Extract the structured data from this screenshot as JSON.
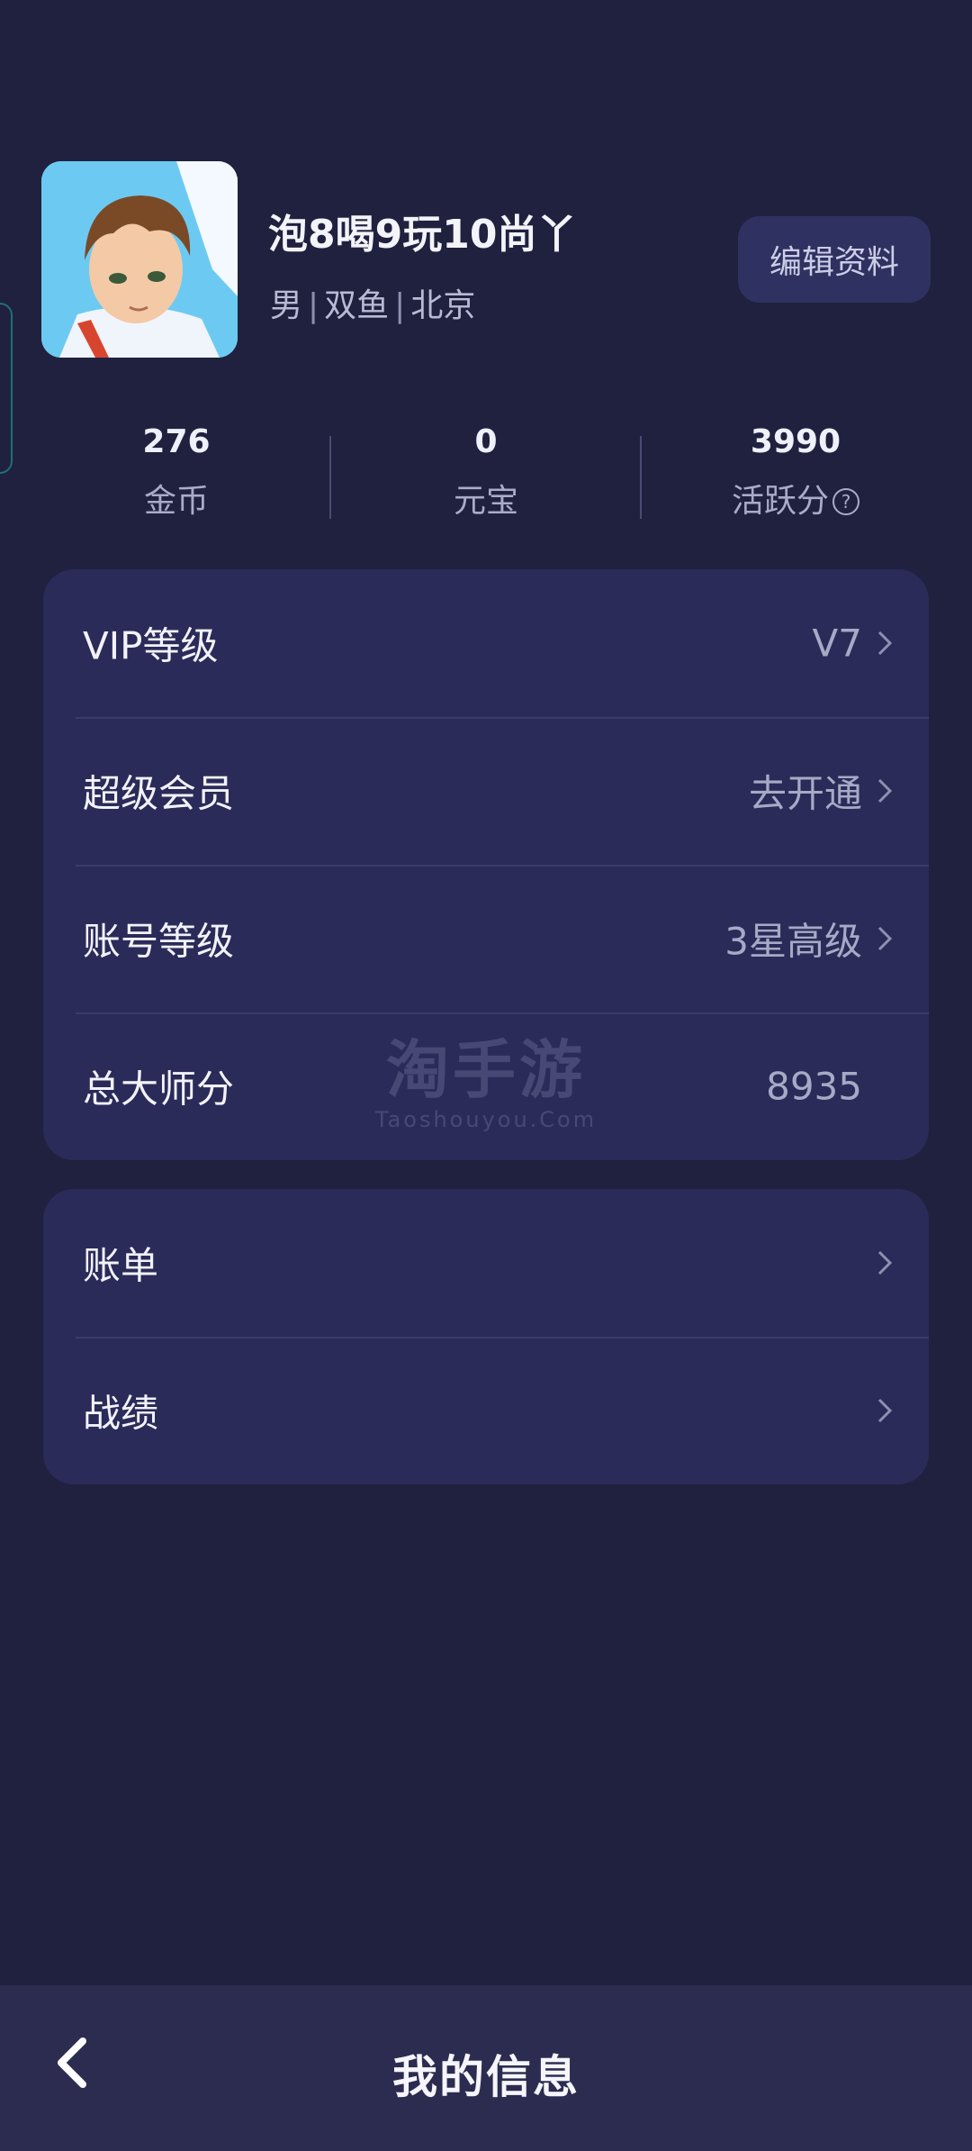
{
  "profile": {
    "nickname": "泡8喝9玩10尚丫",
    "gender": "男",
    "zodiac": "双鱼",
    "city": "北京",
    "edit_label": "编辑资料"
  },
  "stats": [
    {
      "value": "276",
      "label": "金币"
    },
    {
      "value": "0",
      "label": "元宝"
    },
    {
      "value": "3990",
      "label": "活跃分",
      "icon": "help-icon"
    }
  ],
  "levels": [
    {
      "label": "VIP等级",
      "value": "V7",
      "chevron": true
    },
    {
      "label": "超级会员",
      "value": "去开通",
      "chevron": true
    },
    {
      "label": "账号等级",
      "value": "3星高级",
      "chevron": true
    },
    {
      "label": "总大师分",
      "value": "8935",
      "chevron": false
    }
  ],
  "records": [
    {
      "label": "账单",
      "chevron": true
    },
    {
      "label": "战绩",
      "chevron": true
    }
  ],
  "watermark": {
    "main": "淘手游",
    "sub": "Taoshouyou.Com"
  },
  "bottom_bar": {
    "title": "我的信息",
    "back_icon": "chevron-left-icon"
  },
  "colors": {
    "background": "#20213e",
    "card": "#2a2b58",
    "bottom_bar": "#2b2c4f"
  }
}
